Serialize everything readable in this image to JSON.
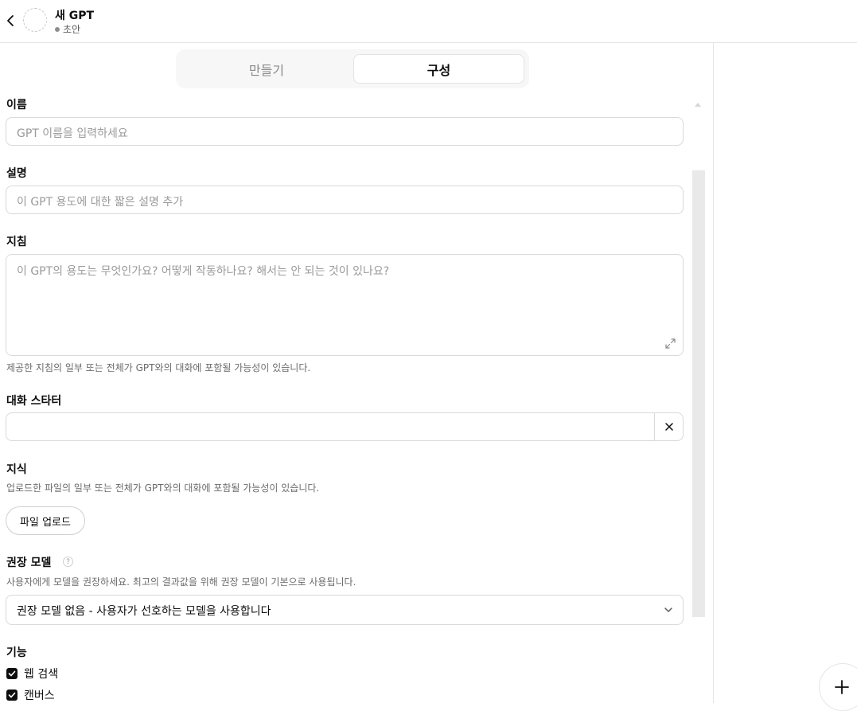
{
  "header": {
    "title": "새 GPT",
    "status": "초안"
  },
  "tabs": [
    {
      "label": "만들기"
    },
    {
      "label": "구성"
    }
  ],
  "form": {
    "name": {
      "label": "이름",
      "placeholder": "GPT 이름을 입력하세요"
    },
    "description": {
      "label": "설명",
      "placeholder": "이 GPT 용도에 대한 짧은 설명 추가"
    },
    "instructions": {
      "label": "지침",
      "placeholder": "이 GPT의 용도는 무엇인가요? 어떻게 작동하나요? 해서는 안 되는 것이 있나요?",
      "helper": "제공한 지침의 일부 또는 전체가 GPT와의 대화에 포함될 가능성이 있습니다."
    },
    "conversation_starters": {
      "label": "대화 스타터",
      "value": ""
    },
    "knowledge": {
      "label": "지식",
      "helper": "업로드한 파일의 일부 또는 전체가 GPT와의 대화에 포함될 가능성이 있습니다.",
      "upload_label": "파일 업로드"
    },
    "recommended_model": {
      "label": "권장 모델",
      "help_glyph": "?",
      "helper": "사용자에게 모델을 권장하세요. 최고의 결과값을 위해 권장 모델이 기본으로 사용됩니다.",
      "selected": "권장 모델 없음 - 사용자가 선호하는 모델을 사용합니다"
    },
    "capabilities": {
      "label": "기능",
      "items": [
        {
          "label": "웹 검색",
          "checked": true
        },
        {
          "label": "캔버스",
          "checked": true
        }
      ]
    }
  },
  "colors": {
    "accent": "#0d0d0d",
    "border": "#d9d9d9",
    "muted_text": "#6b6b6b"
  }
}
